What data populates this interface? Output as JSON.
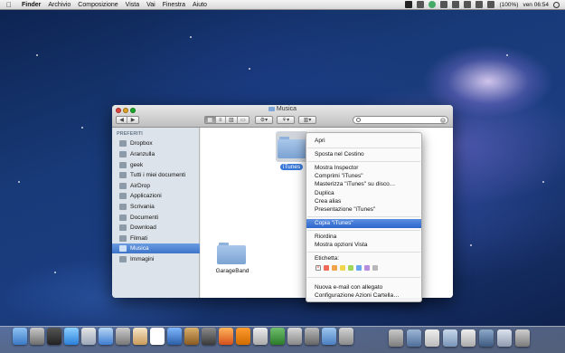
{
  "menubar": {
    "app": "Finder",
    "items": [
      "Archivio",
      "Composizione",
      "Vista",
      "Vai",
      "Finestra",
      "Aiuto"
    ],
    "battery": "(100%)",
    "clock": "ven 06:54"
  },
  "window": {
    "title": "Musica"
  },
  "sidebar": {
    "heading": "PREFERITI",
    "items": [
      {
        "label": "Dropbox",
        "icon": "dropbox-icon"
      },
      {
        "label": "Aranzulla",
        "icon": "folder-icon"
      },
      {
        "label": "geek",
        "icon": "folder-icon"
      },
      {
        "label": "Tutti i miei documenti",
        "icon": "documents-icon"
      },
      {
        "label": "AirDrop",
        "icon": "airdrop-icon"
      },
      {
        "label": "Applicazioni",
        "icon": "applications-icon"
      },
      {
        "label": "Scrivania",
        "icon": "desktop-icon"
      },
      {
        "label": "Documenti",
        "icon": "documents-icon"
      },
      {
        "label": "Download",
        "icon": "download-icon"
      },
      {
        "label": "Filmati",
        "icon": "movies-icon"
      },
      {
        "label": "Musica",
        "icon": "music-icon"
      },
      {
        "label": "Immagini",
        "icon": "pictures-icon"
      }
    ]
  },
  "content": {
    "folders": [
      {
        "label": "GarageBand"
      },
      {
        "label": "iTunes"
      }
    ]
  },
  "context_menu": {
    "items": {
      "open": "Apri",
      "trash": "Sposta nel Cestino",
      "inspector": "Mostra Inspector",
      "compress": "Comprimi \"iTunes\"",
      "burn": "Masterizza \"iTunes\" su disco…",
      "duplicate": "Duplica",
      "alias": "Crea alias",
      "presentation": "Presentazione \"iTunes\"",
      "copy": "Copia \"iTunes\"",
      "arrange": "Riordina",
      "view_options": "Mostra opzioni Vista",
      "label_heading": "Etichetta:",
      "email": "Nuova e-mail con allegato",
      "folder_actions": "Configurazione Azioni Cartella…"
    },
    "label_colors": [
      "#f26a5a",
      "#f2a44a",
      "#f2d64a",
      "#9fd75a",
      "#6aa6f0",
      "#b68de0",
      "#b8b8b8"
    ]
  },
  "colors": {
    "selection": "#3d74c9",
    "menu_highlight": "#2e66cc"
  }
}
